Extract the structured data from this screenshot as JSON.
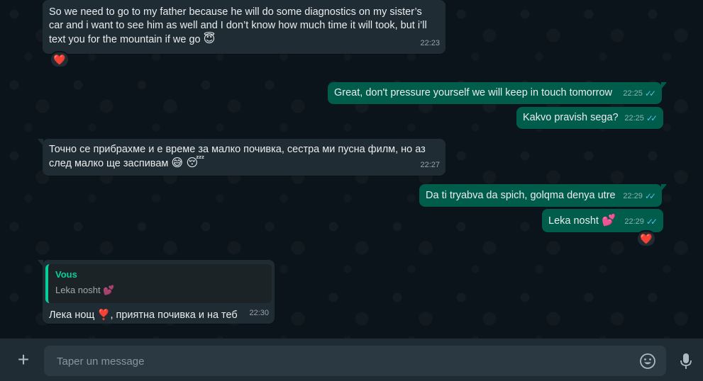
{
  "messages": [
    {
      "text": "So we need to go to my father because he will do some diagnostics on my sister’s car and i want to see him as well and I don’t know how much time it will took, but i’ll text you for the mountain if we go",
      "emoji": "😇",
      "time": "22:23",
      "reaction": "❤️"
    },
    {
      "text": "Great, don't pressure yourself we will keep in touch tomorrow",
      "time": "22:25"
    },
    {
      "text": "Kakvo pravish sega?",
      "time": "22:25"
    },
    {
      "text": "Точно се прибрахме и е време за малко почивка, сестра ми пусна филм, но аз след малко ще заспивам",
      "emoji": "😅 😴",
      "time": "22:27"
    },
    {
      "text": "Da ti tryabva da spich, golqma denya utre",
      "time": "22:29"
    },
    {
      "text": "Leka nosht",
      "emoji": "💕",
      "time": "22:29",
      "reaction": "❤️"
    },
    {
      "quote_author": "Vous",
      "quote_text": "Leka nosht",
      "quote_emoji": "💕",
      "text_before": "Лека нощ",
      "emoji": "❣️",
      "text_after": ", приятна почивка и на теб",
      "time": "22:30"
    }
  ],
  "composer": {
    "placeholder": "Taper un message",
    "icons": [
      "plus-icon",
      "emoji-icon",
      "microphone-icon"
    ]
  },
  "colors": {
    "background": "#0b141a",
    "incoming_bubble": "#202c33",
    "outgoing_bubble": "#005c4b",
    "read_checks": "#53bdeb",
    "quote_accent": "#06cf9c"
  }
}
